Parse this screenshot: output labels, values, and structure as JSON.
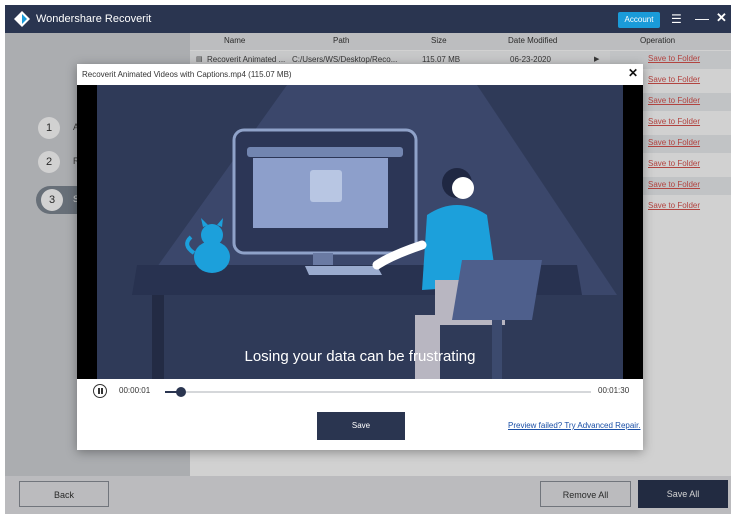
{
  "app": {
    "title": "Wondershare Recoverit",
    "account_label": "Account",
    "menu_glyph": "☰",
    "minimize_glyph": "—",
    "close_glyph": "✕"
  },
  "sidebar": {
    "steps": [
      {
        "num": "1",
        "label": "Ac"
      },
      {
        "num": "2",
        "label": "Re"
      },
      {
        "num": "3",
        "label": "Sa"
      }
    ]
  },
  "table": {
    "headers": {
      "name": "Name",
      "path": "Path",
      "size": "Size",
      "date": "Date Modified",
      "operation": "Operation"
    },
    "row": {
      "name": "Recoverit Animated ...",
      "path": "C:/Users/WS/Desktop/Reco...",
      "size": "115.07 MB",
      "date": "06-23-2020",
      "play_glyph": "▶"
    },
    "operation_link": "Save to Folder"
  },
  "bottom": {
    "back_label": "Back",
    "remove_all_label": "Remove All",
    "save_all_label": "Save All"
  },
  "preview": {
    "title": "Recoverit Animated Videos with Captions.mp4 (115.07 MB)",
    "close_glyph": "✕",
    "caption": "Losing your data can be frustrating",
    "current_time": "00:00:01",
    "total_time": "00:01:30",
    "progress": 0.03,
    "save_label": "Save",
    "repair_link": "Preview failed? Try Advanced Repair."
  },
  "colors": {
    "titlebar": "#2a3550",
    "accent": "#1a9bd9",
    "link_red": "#d9534f",
    "video_bg": "#2f3a58"
  }
}
